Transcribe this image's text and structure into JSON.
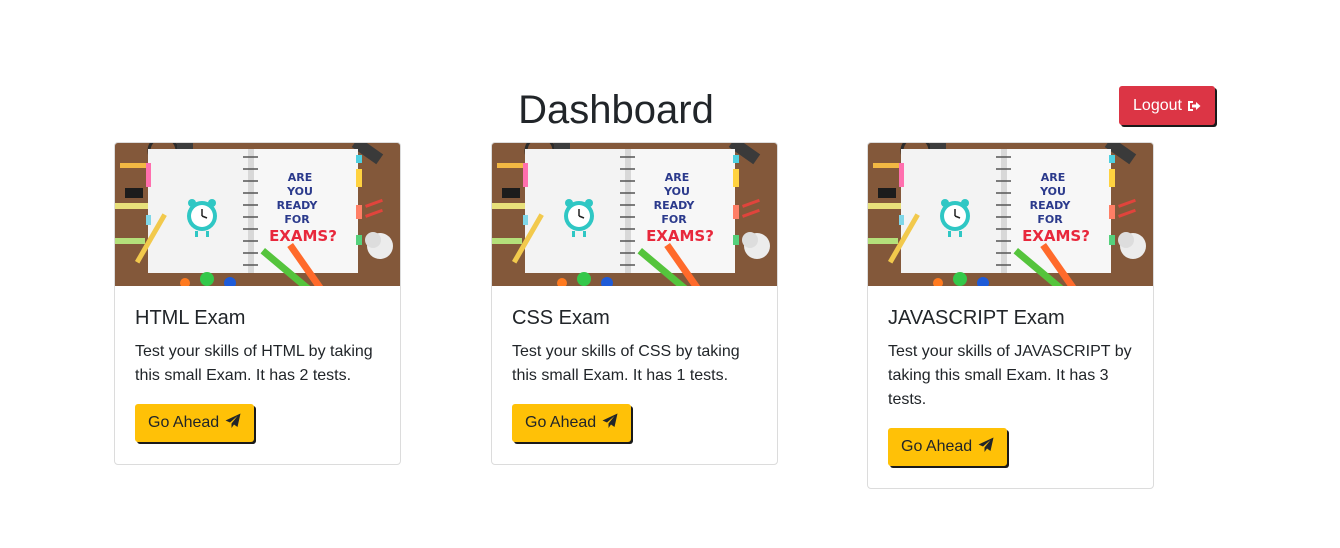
{
  "header": {
    "title": "Dashboard",
    "logout_label": "Logout"
  },
  "image_text": {
    "line1": "ARE",
    "line2": "YOU",
    "line3": "READY",
    "line4": "FOR",
    "line5": "EXAMS?"
  },
  "cards": [
    {
      "title": "HTML Exam",
      "text": "Test your skills of HTML by taking this small Exam. It has 2 tests.",
      "button": "Go Ahead"
    },
    {
      "title": "CSS Exam",
      "text": "Test your skills of CSS by taking this small Exam. It has 1 tests.",
      "button": "Go Ahead"
    },
    {
      "title": "JAVASCRIPT Exam",
      "text": "Test your skills of JAVASCRIPT by taking this small Exam. It has 3 tests.",
      "button": "Go Ahead"
    }
  ],
  "icons": {
    "logout": "sign-out-icon",
    "go": "paper-plane-icon"
  },
  "colors": {
    "logout_button": "#dc3545",
    "go_button": "#ffc107",
    "exam_word": "#e8283c",
    "handwriting": "#2b3a8c"
  }
}
